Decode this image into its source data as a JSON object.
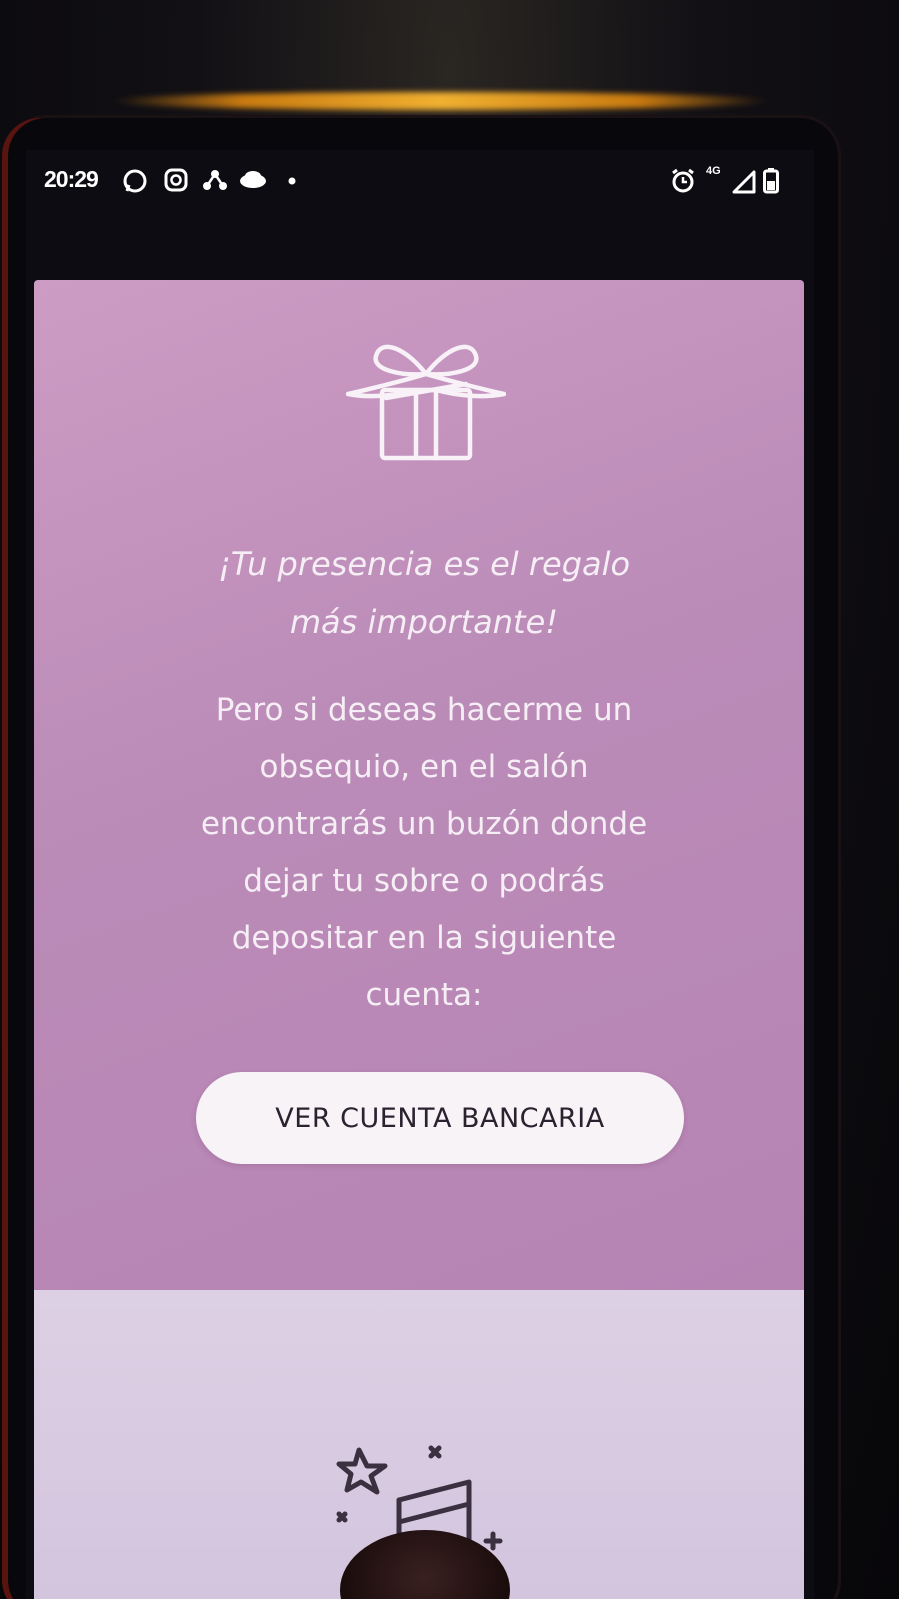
{
  "status_bar": {
    "time": "20:29",
    "left_icons": [
      "whatsapp-icon",
      "instagram-icon",
      "link-icon",
      "cloud-icon",
      "dot-icon"
    ],
    "right_icons": [
      "alarm-icon",
      "4g-icon",
      "signal-icon",
      "battery-icon"
    ],
    "network_label": "4G"
  },
  "gift_section": {
    "icon": "gift-icon",
    "headline_line1": "¡Tu presencia es el regalo",
    "headline_line2": "más importante!",
    "body_lines": [
      "Pero si deseas hacerme un",
      "obsequio, en el salón",
      "encontrarás un buzón donde",
      "dejar tu sobre o podrás",
      "depositar en la siguiente",
      "cuenta:"
    ],
    "button_label": "VER CUENTA BANCARIA"
  },
  "music_section": {
    "icon": "music-note-icon"
  },
  "colors": {
    "card_pink": "#bb8bb8",
    "lower_lilac": "#d8cae0",
    "button_bg": "#f7f3f7",
    "text_light": "#f6eef5"
  }
}
